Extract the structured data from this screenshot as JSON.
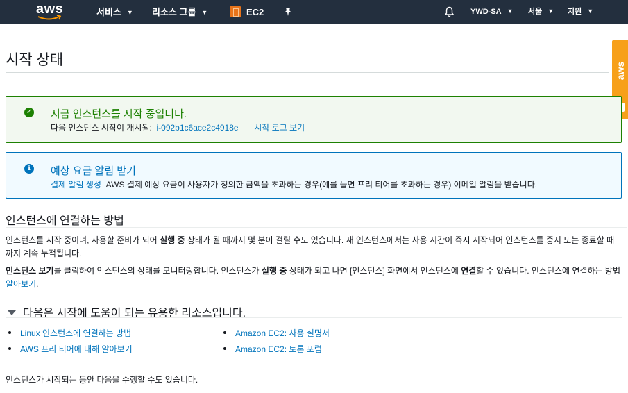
{
  "nav": {
    "logo_text": "aws",
    "services": "서비스",
    "resource_groups": "리소스 그룹",
    "ec2": "EC2",
    "pin_icon": "pin-icon",
    "bell_icon": "bell-icon",
    "account": "YWD-SA",
    "region": "서울",
    "support": "지원"
  },
  "side_tab": {
    "label": "aws"
  },
  "page": {
    "title": "시작 상태"
  },
  "success_alert": {
    "heading": "지금 인스턴스를 시작 중입니다.",
    "line_prefix": "다음 인스턴스 시작이 개시됨:",
    "instance_id": "i-092b1c6ace2c4918e",
    "log_link": "시작 로그 보기"
  },
  "info_alert": {
    "heading": "예상 요금 알림 받기",
    "link": "결제 알림 생성",
    "text": "AWS 결제 예상 요금이 사용자가 정의한 금액을 초과하는 경우(예를 들면 프리 티어를 초과하는 경우) 이메일 알림을 받습니다."
  },
  "connect": {
    "title": "인스턴스에 연결하는 방법",
    "p1_a": "인스턴스를 시작 중이며, 사용할 준비가 되어 ",
    "p1_b": "실행 중",
    "p1_c": " 상태가 될 때까지 몇 분이 걸릴 수도 있습니다. 새 인스턴스에서는 사용 시간이 즉시 시작되어 인스턴스를 중지 또는 종료할 때까지 계속 누적됩니다.",
    "p2_a": "인스턴스 보기",
    "p2_b": "를 클릭하여 인스턴스의 상태를 모니터링합니다. 인스턴스가 ",
    "p2_c": "실행 중",
    "p2_d": " 상태가 되고 나면 [인스턴스] 화면에서 인스턴스에 ",
    "p2_e": "연결",
    "p2_f": "할 수 있습니다. 인스턴스에 연결하는 방법 ",
    "p2_link": "알아보기",
    "p2_g": "."
  },
  "resources": {
    "title": "다음은 시작에 도움이 되는 유용한 리소스입니다.",
    "left": [
      "Linux 인스턴스에 연결하는 방법",
      "AWS 프리 티어에 대해 알아보기"
    ],
    "right": [
      "Amazon EC2: 사용 설명서",
      "Amazon EC2: 토론 포럼"
    ]
  },
  "footer": {
    "text": "인스턴스가 시작되는 동안 다음을 수행할 수도 있습니다."
  }
}
